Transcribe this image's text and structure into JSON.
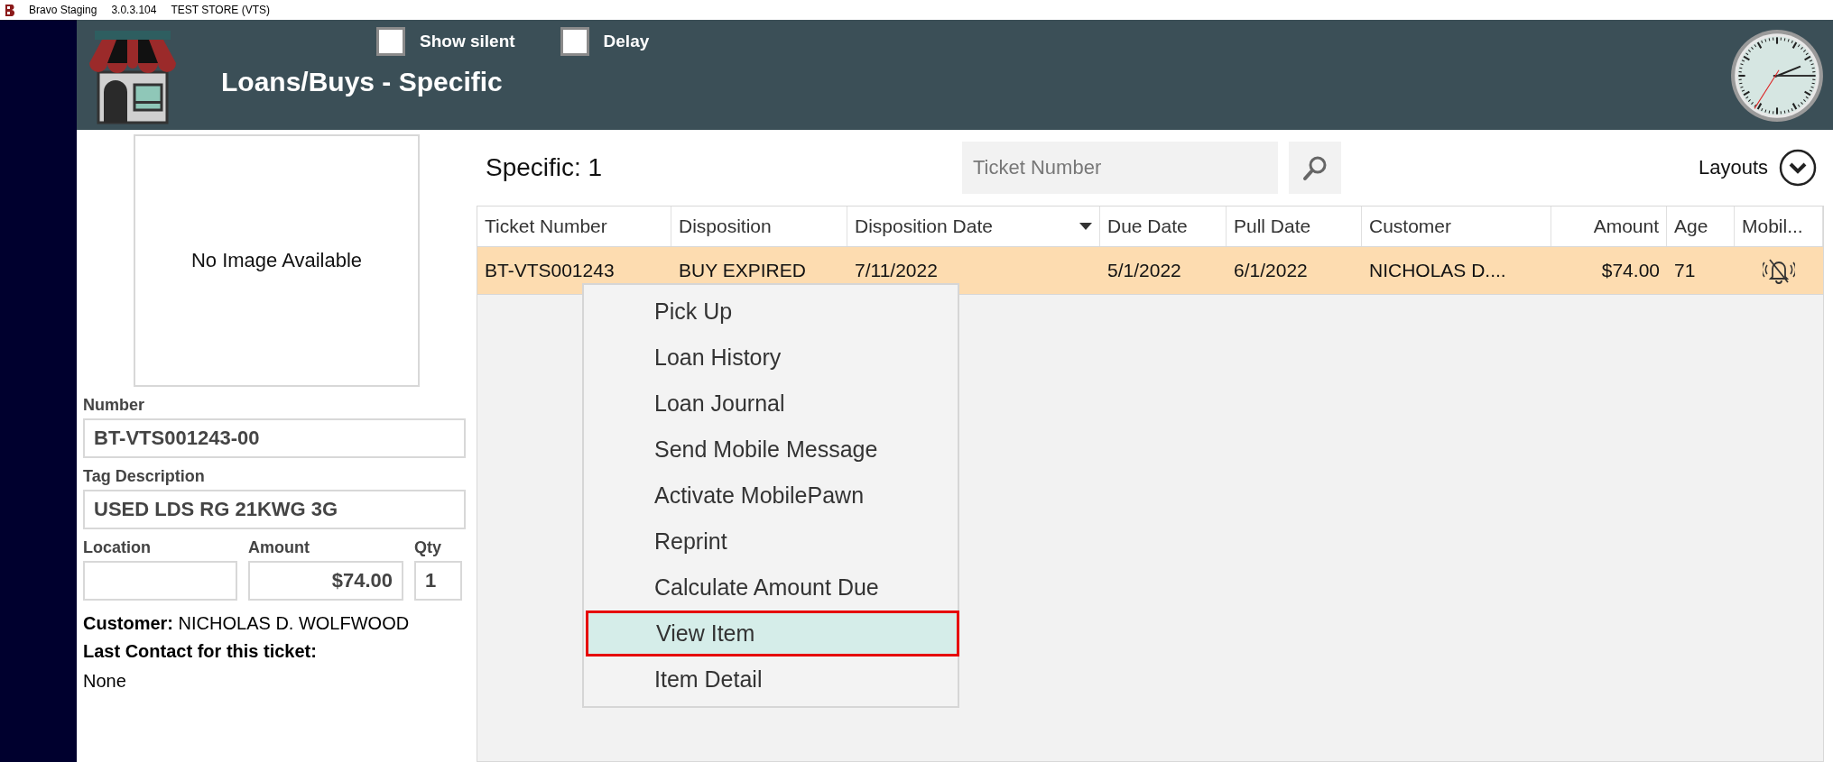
{
  "title_bar": {
    "app": "Bravo Staging",
    "version": "3.0.3.104",
    "store": "TEST STORE (VTS)"
  },
  "header": {
    "title": "Loans/Buys - Specific",
    "options": [
      {
        "label": "Show silent",
        "checked": false
      },
      {
        "label": "Delay",
        "checked": false
      }
    ]
  },
  "item_panel": {
    "image_text": "No Image Available",
    "fields": [
      {
        "label": "Number",
        "value": "BT-VTS001243-00"
      },
      {
        "label": "Tag Description",
        "value": "USED LDS RG 21KWG 3G"
      }
    ],
    "small_fields": [
      {
        "label": "Location"
      },
      {
        "label": "Amount",
        "value": "$74.00"
      },
      {
        "label": "Qty",
        "value": "1"
      }
    ],
    "customer_label": "Customer:",
    "customer": "NICHOLAS D. WOLFWOOD",
    "last_contact_label": "Last Contact for this ticket:",
    "last_contact": "None"
  },
  "list": {
    "heading": "Specific: 1",
    "search": {
      "placeholder": "Ticket Number"
    },
    "layouts": "Layouts"
  },
  "table": {
    "columns": [
      {
        "label": "Ticket Number",
        "sorted": false
      },
      {
        "label": "Disposition",
        "sorted": false
      },
      {
        "label": "Disposition Date",
        "sorted": true
      },
      {
        "label": "Due Date",
        "sorted": false
      },
      {
        "label": "Pull Date",
        "sorted": false
      },
      {
        "label": "Customer",
        "sorted": false
      },
      {
        "label": "Amount",
        "sorted": false
      },
      {
        "label": "Age",
        "sorted": false
      },
      {
        "label": "Mobil...",
        "sorted": false
      }
    ],
    "rows": [
      {
        "selected": true,
        "cells": [
          "BT-VTS001243",
          "BUY EXPIRED",
          "7/11/2022",
          "5/1/2022",
          "6/1/2022",
          "NICHOLAS D....",
          "$74.00",
          "71"
        ],
        "mobile_muted": true
      }
    ]
  },
  "context_menu": {
    "items": [
      {
        "label": "Pick Up",
        "selected": false
      },
      {
        "label": "Loan History",
        "selected": false
      },
      {
        "label": "Loan Journal",
        "selected": false
      },
      {
        "label": "Send Mobile Message",
        "selected": false
      },
      {
        "label": "Activate MobilePawn",
        "selected": false
      },
      {
        "label": "Reprint",
        "selected": false
      },
      {
        "label": "Calculate Amount Due",
        "selected": false
      },
      {
        "label": "View Item",
        "selected": true
      },
      {
        "label": "Item Detail",
        "selected": false
      }
    ]
  }
}
